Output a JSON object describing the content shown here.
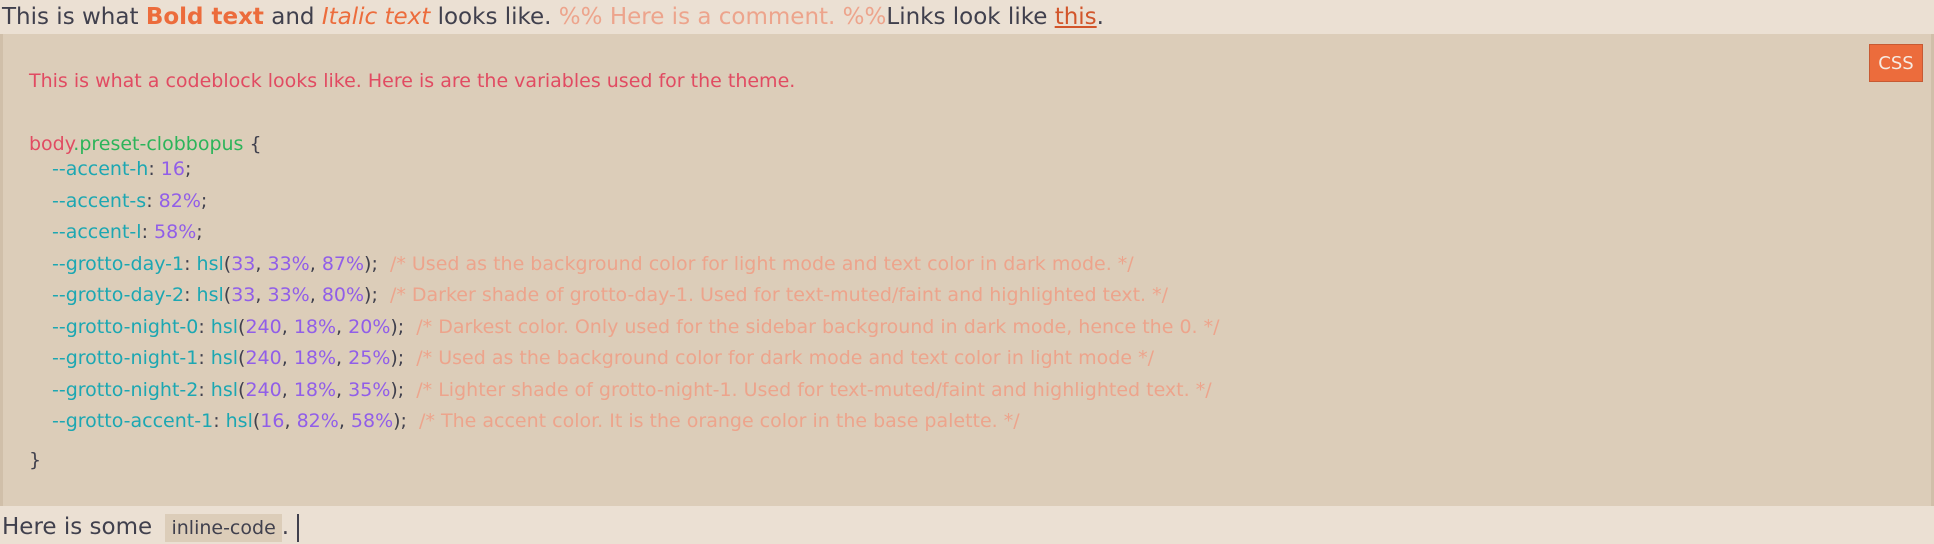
{
  "line1": {
    "prefix": "This is what ",
    "bold": "Bold text",
    "and": " and ",
    "italic": "Italic text",
    "looks": " looks like. ",
    "comment": "%% Here is a comment. %%",
    "links": "Links look like ",
    "link": "this",
    "period": "."
  },
  "codeblock": {
    "language": "CSS",
    "intro": "This is what a codeblock looks like. Here is are the variables used for the theme.",
    "selector_tag": "body",
    "selector_class": ".preset-clobbopus",
    "open_brace": " {",
    "close_brace": "}",
    "hsl_fn": "hsl",
    "vars": [
      {
        "name": "--accent-h",
        "value": "16",
        "comment": ""
      },
      {
        "name": "--accent-s",
        "value": "82%",
        "comment": ""
      },
      {
        "name": "--accent-l",
        "value": "58%",
        "comment": ""
      },
      {
        "name": "--grotto-day-1",
        "args": [
          "33",
          "33%",
          "87%"
        ],
        "comment": "/* Used as the background color for light mode and text color in dark mode. */"
      },
      {
        "name": "--grotto-day-2",
        "args": [
          "33",
          "33%",
          "80%"
        ],
        "comment": "/* Darker shade of grotto-day-1. Used for text-muted/faint and highlighted text. */"
      },
      {
        "name": "--grotto-night-0",
        "args": [
          "240",
          "18%",
          "20%"
        ],
        "comment": "/* Darkest color. Only used for the sidebar background in dark mode, hence the 0. */"
      },
      {
        "name": "--grotto-night-1",
        "args": [
          "240",
          "18%",
          "25%"
        ],
        "comment": "/* Used as the background color for dark mode and text color in light mode */"
      },
      {
        "name": "--grotto-night-2",
        "args": [
          "240",
          "18%",
          "35%"
        ],
        "comment": "/* Lighter shade of grotto-night-1. Used for text-muted/faint and highlighted text. */"
      },
      {
        "name": "--grotto-accent-1",
        "args": [
          "16",
          "82%",
          "58%"
        ],
        "comment": "/* The accent color. It is the orange color in the base palette. */"
      }
    ]
  },
  "line3": {
    "prefix": "Here is some ",
    "code": "inline-code",
    "suffix": "."
  }
}
